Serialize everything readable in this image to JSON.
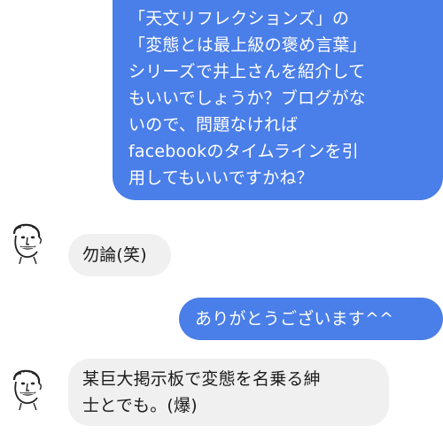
{
  "messages": [
    {
      "direction": "outgoing",
      "text": "「天文リフレクションズ」の\n「変態とは最上級の褒め言葉」\nシリーズで井上さんを紹介して\nもいいでしょうか？ブログがな\nいので、問題なければ\nfacebookのタイムラインを引\n用してもいいですかね？"
    },
    {
      "direction": "incoming",
      "avatar": "cartoon-face-icon",
      "text": "勿論(笑)"
    },
    {
      "direction": "outgoing",
      "text": "ありがとうございます^^"
    },
    {
      "direction": "incoming",
      "avatar": "cartoon-face-icon",
      "text": "某巨大掲示板で変態を名乗る紳\n士とでも。(爆)"
    }
  ],
  "colors": {
    "outgoing_bubble": "#4a7ee8",
    "incoming_bubble": "#f0f0f0",
    "outgoing_text": "#ffffff",
    "incoming_text": "#1c1c1c"
  }
}
